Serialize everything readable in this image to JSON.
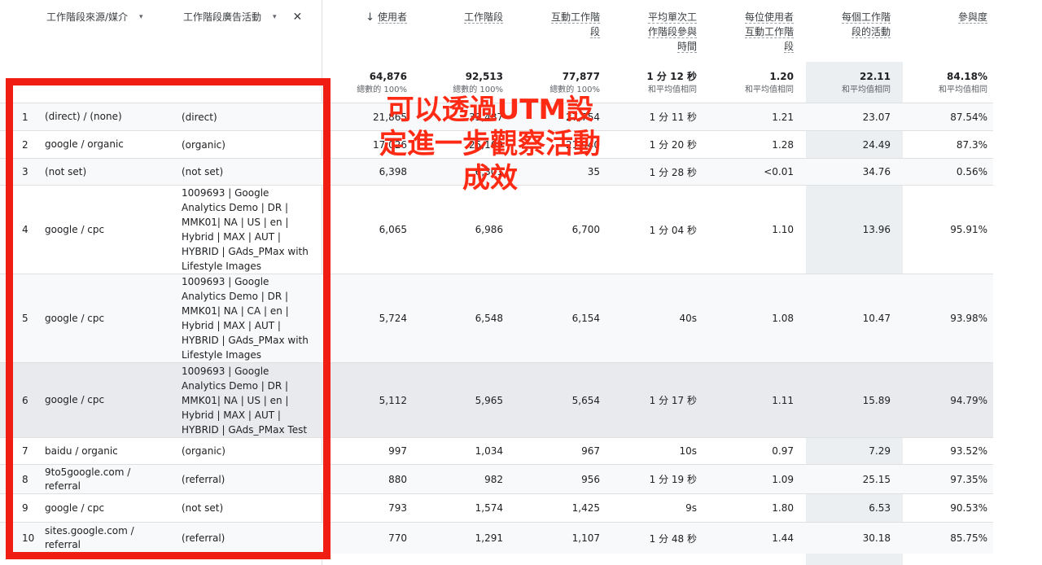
{
  "header": {
    "dim1": "工作階段來源/媒介",
    "dim2": "工作階段廣告活動",
    "dim_caret": "▾",
    "close": "✕",
    "sort_arrow": "↓",
    "metrics": [
      [
        "使用者"
      ],
      [
        "工作階段"
      ],
      [
        "互動工作階",
        "段"
      ],
      [
        "平均單次工",
        "作階段參與",
        "時間"
      ],
      [
        "每位使用者",
        "互動工作階",
        "段"
      ],
      [
        "每個工作階",
        "段的活動"
      ],
      [
        "參與度"
      ]
    ]
  },
  "totals": [
    {
      "value": "64,876",
      "sub": "總數的 100%"
    },
    {
      "value": "92,513",
      "sub": "總數的 100%"
    },
    {
      "value": "77,877",
      "sub": "總數的 100%"
    },
    {
      "value": "1 分 12 秒",
      "sub": "和平均值相同"
    },
    {
      "value": "1.20",
      "sub": "和平均值相同"
    },
    {
      "value": "22.11",
      "sub": "和平均值相同"
    },
    {
      "value": "84.18%",
      "sub": "和平均值相同"
    }
  ],
  "rows": [
    {
      "idx": "1",
      "src": "(direct) / (none)",
      "cmp": "(direct)",
      "m": [
        "21,865",
        "33,487",
        "27,754",
        "1 分 11 秒",
        "1.21",
        "23.07",
        "87.54%"
      ]
    },
    {
      "idx": "2",
      "src": "google / organic",
      "cmp": "(organic)",
      "m": [
        "17,026",
        "25,169",
        "21,940",
        "1 分 20 秒",
        "1.28",
        "24.49",
        "87.3%"
      ]
    },
    {
      "idx": "3",
      "src": "(not set)",
      "cmp": "(not set)",
      "m": [
        "6,398",
        "6,301",
        "35",
        "1 分 28 秒",
        "<0.01",
        "34.76",
        "0.56%"
      ]
    },
    {
      "idx": "4",
      "src": "google / cpc",
      "cmp": "1009693 | Google Analytics Demo | DR | MMK01| NA | US | en | Hybrid | MAX | AUT | HYBRID | GAds_PMax with Lifestyle Images",
      "m": [
        "6,065",
        "6,986",
        "6,700",
        "1 分 04 秒",
        "1.10",
        "13.96",
        "95.91%"
      ]
    },
    {
      "idx": "5",
      "src": "google / cpc",
      "cmp": "1009693 | Google Analytics Demo | DR | MMK01| NA | CA | en | Hybrid | MAX | AUT | HYBRID | GAds_PMax with Lifestyle Images",
      "m": [
        "5,724",
        "6,548",
        "6,154",
        "40s",
        "1.08",
        "10.47",
        "93.98%"
      ]
    },
    {
      "idx": "6",
      "src": "google / cpc",
      "cmp": "1009693 | Google Analytics Demo | DR | MMK01| NA | US | en | Hybrid | MAX | AUT | HYBRID | GAds_PMax Test",
      "m": [
        "5,112",
        "5,965",
        "5,654",
        "1 分 17 秒",
        "1.11",
        "15.89",
        "94.79%"
      ]
    },
    {
      "idx": "7",
      "src": "baidu / organic",
      "cmp": "(organic)",
      "m": [
        "997",
        "1,034",
        "967",
        "10s",
        "0.97",
        "7.29",
        "93.52%"
      ]
    },
    {
      "idx": "8",
      "src": "9to5google.com / referral",
      "cmp": "(referral)",
      "m": [
        "880",
        "982",
        "956",
        "1 分 19 秒",
        "1.09",
        "25.15",
        "97.35%"
      ]
    },
    {
      "idx": "9",
      "src": "google / cpc",
      "cmp": "(not set)",
      "m": [
        "793",
        "1,574",
        "1,425",
        "9s",
        "1.80",
        "6.53",
        "90.53%"
      ]
    },
    {
      "idx": "10",
      "src": "sites.google.com / referral",
      "cmp": "(referral)",
      "m": [
        "770",
        "1,291",
        "1,107",
        "1 分 48 秒",
        "1.44",
        "30.18",
        "85.75%"
      ]
    }
  ],
  "annotation": [
    "可以透過UTM設",
    "定進一步觀察活動",
    "成效"
  ],
  "colors": {
    "annotation": "#ff2a14",
    "box": "#f01e12",
    "highlight_column": "#eceff1"
  }
}
